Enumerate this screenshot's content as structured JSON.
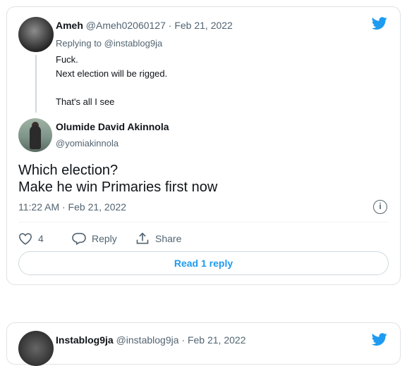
{
  "tweet": {
    "reply": {
      "name": "Ameh",
      "handle": "@Ameh02060127",
      "separator": "·",
      "date": "Feb 21, 2022",
      "replying_to": "Replying to @instablog9ja",
      "lines": [
        "Fuck.",
        "Next election will be rigged.",
        "That's all I see"
      ]
    },
    "main": {
      "name": "Olumide David Akinnola",
      "handle": "@yomiakinnola",
      "lines": [
        "Which election?",
        "Make he win Primaries first now"
      ],
      "timestamp": "11:22 AM · Feb 21, 2022",
      "like_count": "4",
      "reply_label": "Reply",
      "share_label": "Share",
      "read_replies_label": "Read 1 reply"
    }
  },
  "next_tweet": {
    "name": "Instablog9ja",
    "handle": "@instablog9ja",
    "separator": "·",
    "date": "Feb 21, 2022"
  },
  "colors": {
    "twitter_blue": "#1d9bf0",
    "muted_text": "#536471",
    "border": "#dfe3e6"
  },
  "icons": [
    "twitter-bird-icon",
    "info-icon",
    "heart-icon",
    "reply-icon",
    "share-icon"
  ]
}
